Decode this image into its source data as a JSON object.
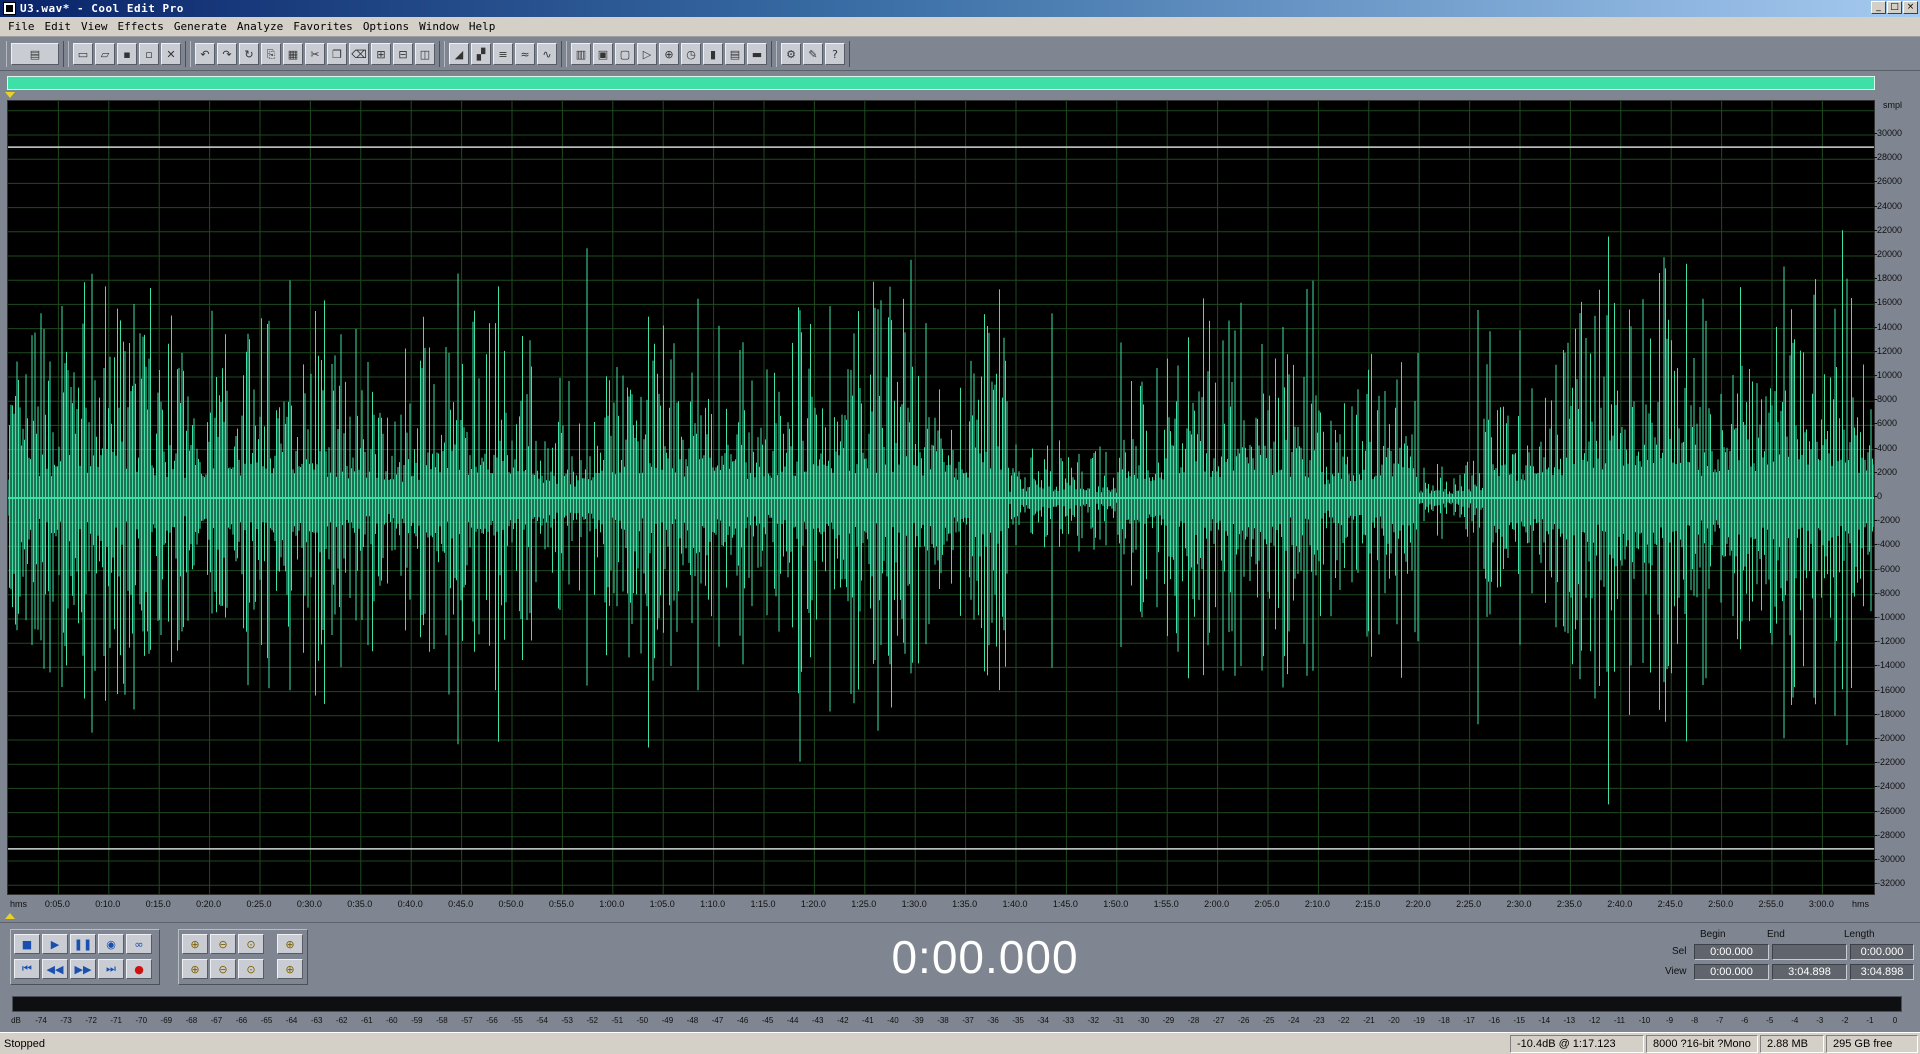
{
  "window": {
    "title": "U3.wav* - Cool Edit Pro",
    "buttons": [
      "_",
      "□",
      "×"
    ]
  },
  "menu": [
    "File",
    "Edit",
    "View",
    "Effects",
    "Generate",
    "Analyze",
    "Favorites",
    "Options",
    "Window",
    "Help"
  ],
  "toolbar": {
    "groups": [
      [
        "multitrack-toggle"
      ],
      [
        "new-file",
        "open-file",
        "save-file",
        "save-as",
        "close-file"
      ],
      [
        "undo",
        "redo",
        "repeat-last",
        "copy-to-new",
        "paste",
        "cut",
        "copy",
        "delete",
        "mix-paste",
        "trim",
        "convert-sample-type"
      ],
      [
        "envelope",
        "normalize",
        "equalizer",
        "noise-reduction",
        "dynamics"
      ],
      [
        "spectral-view",
        "waveform-view",
        "select-entire",
        "play-loop",
        "zoom-selection",
        "time-display",
        "markers",
        "cue-list",
        "play-list"
      ],
      [
        "settings",
        "scripts",
        "help"
      ]
    ],
    "tooltips_visible": false
  },
  "waveform": {
    "color": "#3fe0a8",
    "background": "#000000",
    "grid_color": "#1f4a1f",
    "clip_line_color": "#cfd8d4",
    "y_unit": "smpl",
    "y_ticks": [
      "30000",
      "28000",
      "26000",
      "24000",
      "22000",
      "20000",
      "18000",
      "16000",
      "14000",
      "12000",
      "10000",
      "8000",
      "6000",
      "4000",
      "2000",
      "0",
      "-2000",
      "-4000",
      "-6000",
      "-8000",
      "-10000",
      "-12000",
      "-14000",
      "-16000",
      "-18000",
      "-20000",
      "-22000",
      "-24000",
      "-26000",
      "-28000",
      "-30000",
      "-32000"
    ],
    "x_unit_left": "hms",
    "x_unit_right": "hms",
    "x_ticks": [
      "0:05.0",
      "0:10.0",
      "0:15.0",
      "0:20.0",
      "0:25.0",
      "0:30.0",
      "0:35.0",
      "0:40.0",
      "0:45.0",
      "0:50.0",
      "0:55.0",
      "1:00.0",
      "1:05.0",
      "1:10.0",
      "1:15.0",
      "1:20.0",
      "1:25.0",
      "1:30.0",
      "1:35.0",
      "1:40.0",
      "1:45.0",
      "1:50.0",
      "1:55.0",
      "2:00.0",
      "2:05.0",
      "2:10.0",
      "2:15.0",
      "2:20.0",
      "2:25.0",
      "2:30.0",
      "2:35.0",
      "2:40.0",
      "2:45.0",
      "2:50.0",
      "2:55.0",
      "3:00.0"
    ]
  },
  "transport": {
    "time": "0:00.000",
    "buttons": [
      "stop",
      "play",
      "pause",
      "play-to-end",
      "loop",
      "go-to-start",
      "rewind",
      "fast-forward",
      "go-to-end",
      "record"
    ],
    "zoom_buttons": [
      "zoom-in-h",
      "zoom-out-h",
      "zoom-full-h",
      "zoom-in-left",
      "zoom-in-v",
      "zoom-out-v",
      "zoom-full-v",
      "zoom-in-right"
    ]
  },
  "selection": {
    "headers": {
      "begin": "Begin",
      "end": "End",
      "length": "Length"
    },
    "sel": {
      "label": "Sel",
      "begin": "0:00.000",
      "end": "",
      "length": "0:00.000"
    },
    "view": {
      "label": "View",
      "begin": "0:00.000",
      "end": "3:04.898",
      "length": "3:04.898"
    }
  },
  "meter": {
    "ticks": [
      "dB",
      "-74",
      "-73",
      "-72",
      "-71",
      "-70",
      "-69",
      "-68",
      "-67",
      "-66",
      "-65",
      "-64",
      "-63",
      "-62",
      "-61",
      "-60",
      "-59",
      "-58",
      "-57",
      "-56",
      "-55",
      "-54",
      "-53",
      "-52",
      "-51",
      "-50",
      "-49",
      "-48",
      "-47",
      "-46",
      "-45",
      "-44",
      "-43",
      "-42",
      "-41",
      "-40",
      "-39",
      "-38",
      "-37",
      "-36",
      "-35",
      "-34",
      "-33",
      "-32",
      "-31",
      "-30",
      "-29",
      "-28",
      "-27",
      "-26",
      "-25",
      "-24",
      "-23",
      "-22",
      "-21",
      "-20",
      "-19",
      "-18",
      "-17",
      "-16",
      "-15",
      "-14",
      "-13",
      "-12",
      "-11",
      "-10",
      "-9",
      "-8",
      "-7",
      "-6",
      "-5",
      "-4",
      "-3",
      "-2",
      "-1",
      "0"
    ]
  },
  "status": {
    "state": "Stopped",
    "level": "-10.4dB @  1:17.123",
    "format": "8000 ?16-bit ?Mono",
    "size": "2.88 MB",
    "free": "295 GB free"
  }
}
